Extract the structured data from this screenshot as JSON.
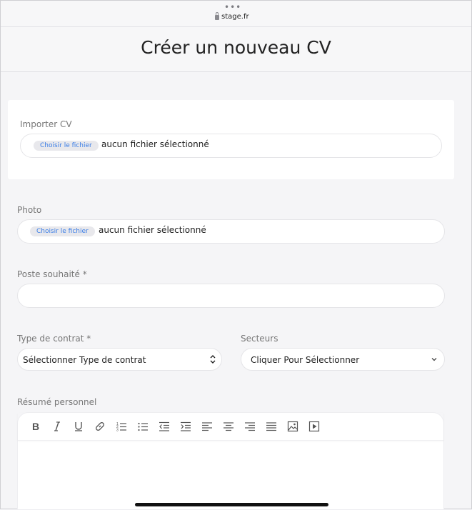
{
  "browser": {
    "dots": "•••",
    "url": "stage.fr"
  },
  "header": {
    "title": "Créer un nouveau CV"
  },
  "form": {
    "import_cv": {
      "label": "Importer CV",
      "button": "Choisir le fichier",
      "status": "aucun fichier sélectionné"
    },
    "photo": {
      "label": "Photo",
      "button": "Choisir le fichier",
      "status": "aucun fichier sélectionné"
    },
    "poste": {
      "label": "Poste souhaité *",
      "value": ""
    },
    "contrat": {
      "label": "Type de contrat *",
      "selected": "Sélectionner Type de contrat"
    },
    "secteurs": {
      "label": "Secteurs",
      "selected": "Cliquer Pour Sélectionner"
    },
    "resume": {
      "label": "Résumé personnel",
      "toolbar": [
        "bold-icon",
        "italic-icon",
        "underline-icon",
        "link-icon",
        "ordered-list-icon",
        "bullet-list-icon",
        "outdent-icon",
        "indent-icon",
        "align-left-icon",
        "align-center-icon",
        "align-right-icon",
        "align-justify-icon",
        "image-icon",
        "video-icon"
      ]
    }
  },
  "colors": {
    "accent_link": "#3b7ee6",
    "background": "#f5f5f7",
    "field_border": "#e5e5e8"
  }
}
